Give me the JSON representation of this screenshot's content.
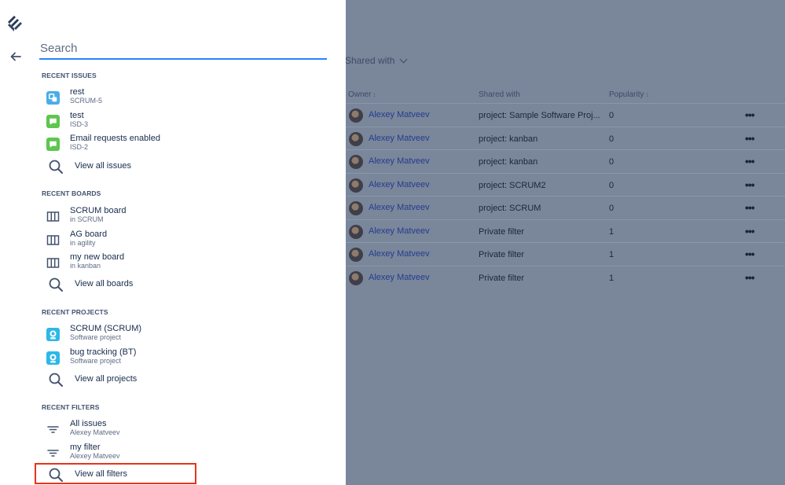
{
  "background": {
    "shared_with_filter": "Shared with",
    "columns": {
      "owner": "Owner",
      "shared_with": "Shared with",
      "popularity": "Popularity"
    },
    "rows": [
      {
        "owner": "Alexey Matveev",
        "shared_with": "project: Sample Software Proj...",
        "popularity": "0"
      },
      {
        "owner": "Alexey Matveev",
        "shared_with": "project: kanban",
        "popularity": "0"
      },
      {
        "owner": "Alexey Matveev",
        "shared_with": "project: kanban",
        "popularity": "0"
      },
      {
        "owner": "Alexey Matveev",
        "shared_with": "project: SCRUM2",
        "popularity": "0"
      },
      {
        "owner": "Alexey Matveev",
        "shared_with": "project: SCRUM",
        "popularity": "0"
      },
      {
        "owner": "Alexey Matveev",
        "shared_with": "Private filter",
        "popularity": "1"
      },
      {
        "owner": "Alexey Matveev",
        "shared_with": "Private filter",
        "popularity": "1"
      },
      {
        "owner": "Alexey Matveev",
        "shared_with": "Private filter",
        "popularity": "1"
      }
    ],
    "more_label": "•••"
  },
  "search": {
    "placeholder": "Search",
    "value": ""
  },
  "recent_issues": {
    "title": "RECENT ISSUES",
    "items": [
      {
        "title": "rest",
        "sub": "SCRUM-5",
        "icon": "subtask-icon",
        "color": "#4bade8"
      },
      {
        "title": "test",
        "sub": "ISD-3",
        "icon": "service-request-icon",
        "color": "#5dc64e"
      },
      {
        "title": "Email requests enabled",
        "sub": "ISD-2",
        "icon": "service-request-icon",
        "color": "#5dc64e"
      }
    ],
    "view_all": "View all issues"
  },
  "recent_boards": {
    "title": "RECENT BOARDS",
    "items": [
      {
        "title": "SCRUM board",
        "sub": "in SCRUM"
      },
      {
        "title": "AG board",
        "sub": "in agility"
      },
      {
        "title": "my new board",
        "sub": "in kanban"
      }
    ],
    "view_all": "View all boards"
  },
  "recent_projects": {
    "title": "RECENT PROJECTS",
    "items": [
      {
        "title": "SCRUM (SCRUM)",
        "sub": "Software project"
      },
      {
        "title": "bug tracking (BT)",
        "sub": "Software project"
      }
    ],
    "view_all": "View all projects"
  },
  "recent_filters": {
    "title": "RECENT FILTERS",
    "items": [
      {
        "title": "All issues",
        "sub": "Alexey Matveev"
      },
      {
        "title": "my filter",
        "sub": "Alexey Matveev"
      }
    ],
    "view_all": "View all filters"
  },
  "colors": {
    "accent": "#2684ff",
    "highlight": "#e8341b",
    "overlay": "#7a869a"
  }
}
